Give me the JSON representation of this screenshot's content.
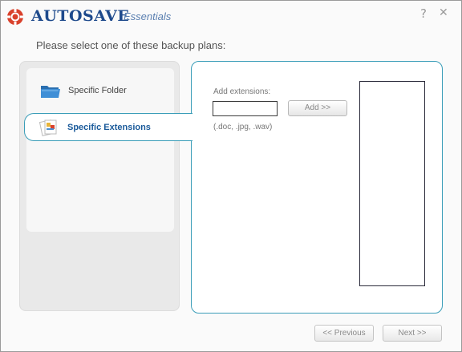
{
  "app": {
    "name": "AUTOSAVE",
    "subtitle": "Essentials"
  },
  "titlebar": {
    "help": "?",
    "close": "✕"
  },
  "prompt": "Please select one of these backup plans:",
  "plans": [
    {
      "label": "Specific Folder",
      "icon": "folder-icon",
      "selected": false
    },
    {
      "label": "Specific Extensions",
      "icon": "documents-icon",
      "selected": true
    }
  ],
  "extensions": {
    "label": "Add extensions:",
    "value": "",
    "add_button": "Add >>",
    "hint": "(.doc, .jpg, .wav)",
    "list": []
  },
  "nav": {
    "previous": "<< Previous",
    "next": "Next >>"
  },
  "colors": {
    "accent": "#3a9db8",
    "brand": "#1e4a8c",
    "logo": "#d9412b"
  }
}
